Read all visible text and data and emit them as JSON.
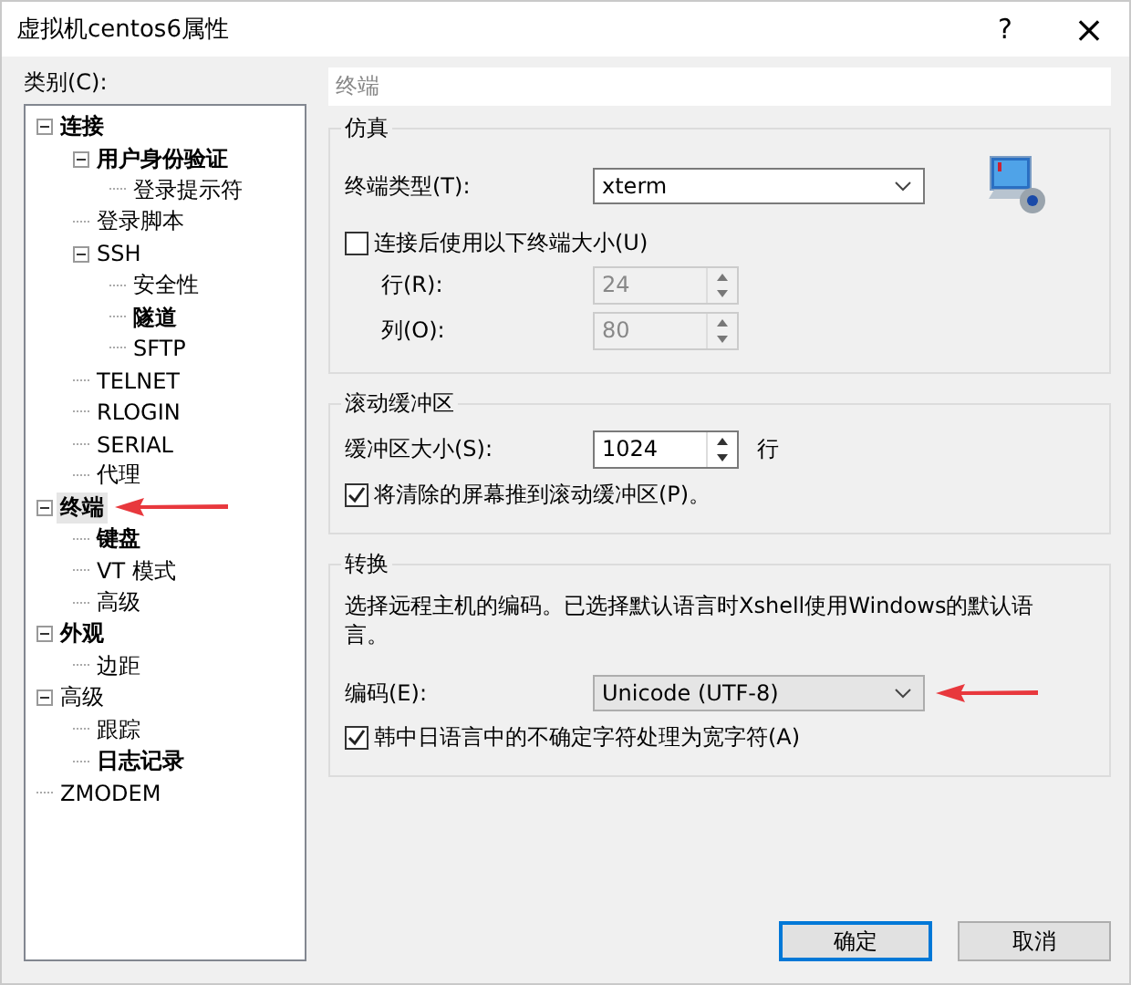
{
  "window": {
    "title": "虚拟机centos6属性",
    "help": "?",
    "close": "×"
  },
  "category_label": "类别(C):",
  "tree": [
    {
      "label": "连接",
      "bold": true,
      "expanded": true,
      "selected": false,
      "children": [
        {
          "label": "用户身份验证",
          "bold": true,
          "expanded": true,
          "selected": false,
          "children": [
            {
              "label": "登录提示符",
              "bold": false,
              "selected": false
            }
          ]
        },
        {
          "label": "登录脚本",
          "bold": false,
          "selected": false
        },
        {
          "label": "SSH",
          "bold": false,
          "expanded": true,
          "selected": false,
          "children": [
            {
              "label": "安全性",
              "bold": false,
              "selected": false
            },
            {
              "label": "隧道",
              "bold": true,
              "selected": false
            },
            {
              "label": "SFTP",
              "bold": false,
              "selected": false
            }
          ]
        },
        {
          "label": "TELNET",
          "bold": false,
          "selected": false
        },
        {
          "label": "RLOGIN",
          "bold": false,
          "selected": false
        },
        {
          "label": "SERIAL",
          "bold": false,
          "selected": false
        },
        {
          "label": "代理",
          "bold": false,
          "selected": false
        }
      ]
    },
    {
      "label": "终端",
      "bold": true,
      "expanded": true,
      "selected": true,
      "children": [
        {
          "label": "键盘",
          "bold": true,
          "selected": false
        },
        {
          "label": "VT 模式",
          "bold": false,
          "selected": false
        },
        {
          "label": "高级",
          "bold": false,
          "selected": false
        }
      ]
    },
    {
      "label": "外观",
      "bold": true,
      "expanded": true,
      "selected": false,
      "children": [
        {
          "label": "边距",
          "bold": false,
          "selected": false
        }
      ]
    },
    {
      "label": "高级",
      "bold": false,
      "expanded": true,
      "selected": false,
      "children": [
        {
          "label": "跟踪",
          "bold": false,
          "selected": false
        },
        {
          "label": "日志记录",
          "bold": true,
          "selected": false
        }
      ]
    },
    {
      "label": "ZMODEM",
      "bold": false,
      "selected": false
    }
  ],
  "page_header": "终端",
  "emulation": {
    "title": "仿真",
    "terminal_type_label": "终端类型(T):",
    "terminal_type": "xterm",
    "use_size": {
      "label": "连接后使用以下终端大小(U)",
      "checked": false
    },
    "rows_label": "行(R):",
    "rows": "24",
    "cols_label": "列(O):",
    "cols": "80"
  },
  "scrollback": {
    "title": "滚动缓冲区",
    "size_label": "缓冲区大小(S):",
    "size": "1024",
    "unit": "行",
    "push_cleared": {
      "label": "将清除的屏幕推到滚动缓冲区(P)。",
      "checked": true
    }
  },
  "translation": {
    "title": "转换",
    "description": "选择远程主机的编码。已选择默认语言时Xshell使用Windows的默认语言。",
    "encoding_label": "编码(E):",
    "encoding": "Unicode (UTF-8)",
    "cjk_wide": {
      "label": "韩中日语言中的不确定字符处理为宽字符(A)",
      "checked": true
    }
  },
  "buttons": [
    {
      "label": "确定",
      "default": true
    },
    {
      "label": "取消",
      "default": false
    }
  ]
}
